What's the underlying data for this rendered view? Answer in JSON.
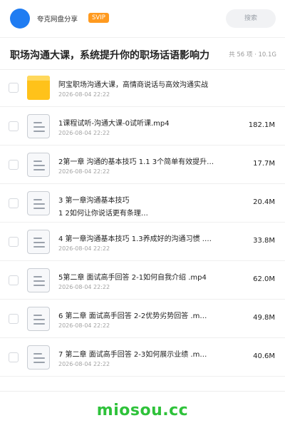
{
  "header": {
    "brand": "夸克网盘分享",
    "badge": "SVIP",
    "search_label": "搜索"
  },
  "share": {
    "title": "职场沟通大课，系统提升你的职场话语影响力",
    "meta": "共 56 项 · 10.1G"
  },
  "files": [
    {
      "type": "folder",
      "name": "阿宝职场沟通大课，高情商说话与高效沟通实战",
      "date": "2026-08-04 22:22",
      "size": ""
    },
    {
      "type": "file",
      "name": "1课程试听-沟通大课-0试听课.mp4",
      "date": "2026-08-04 22:22",
      "size": "182.1M"
    },
    {
      "type": "file",
      "name": "2第一章 沟通的基本技巧 1.1 3个简单有效提升…",
      "date": "2026-08-04 22:22",
      "size": "17.7M"
    },
    {
      "type": "file",
      "name": "3 第一章沟通基本技巧",
      "date": "",
      "sub": "1 2如何让你说话更有条理…",
      "size": "20.4M"
    },
    {
      "type": "file",
      "name": "4 第一章沟通基本技巧 1.3养成好的沟通习惯 .…",
      "date": "2026-08-04 22:22",
      "size": "33.8M"
    },
    {
      "type": "file",
      "name": "5第二章 面试高手回答 2-1如何自我介绍 .mp4",
      "date": "2026-08-04 22:22",
      "size": "62.0M"
    },
    {
      "type": "file",
      "name": "6 第二章 面试高手回答 2-2优势劣势回答 .m…",
      "date": "2026-08-04 22:22",
      "size": "49.8M"
    },
    {
      "type": "file",
      "name": "7 第二章 面试高手回答 2-3如何展示业绩 .m…",
      "date": "2026-08-04 22:22",
      "size": "40.6M"
    }
  ],
  "footer": {
    "watermark": "miosou.cc"
  },
  "colors": {
    "accent": "#1f7cf2",
    "badge": "#ff9a1f",
    "folder": "#ffc21a",
    "watermark": "#2ec23a"
  }
}
